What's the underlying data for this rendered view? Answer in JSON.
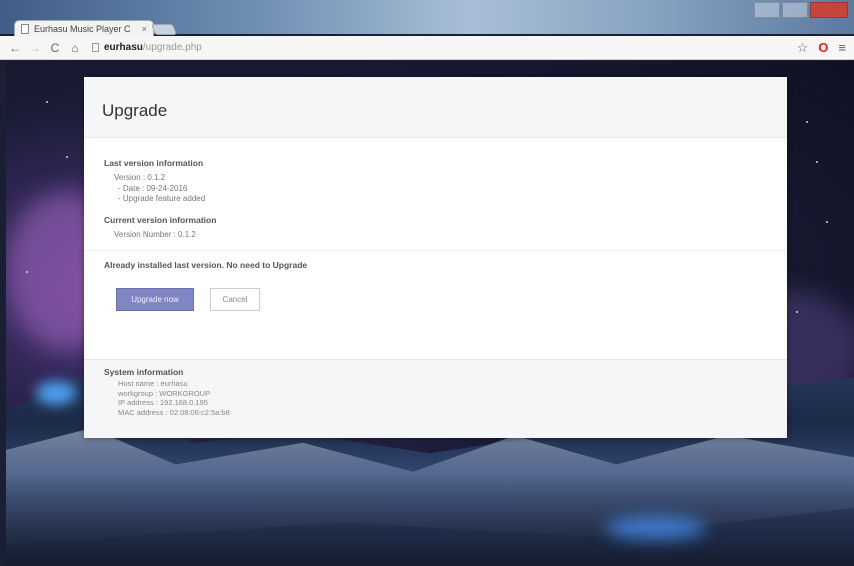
{
  "browser": {
    "tab_title": "Eurhasu Music Player C",
    "tab_close": "×",
    "back": "←",
    "forward": "→",
    "reload": "C",
    "home": "⌂",
    "url_host": "eurhasu",
    "url_path": "/upgrade.php",
    "star": "☆",
    "opera": "O",
    "menu": "≡"
  },
  "page": {
    "title": "Upgrade",
    "last_version": {
      "heading": "Last version information",
      "version": "Version : 0.1.2",
      "date": "- Date : 09-24-2016",
      "features": "- Upgrade feature added"
    },
    "current_version": {
      "heading": "Current version information",
      "number": "Version Number : 0.1.2"
    },
    "status": "Already installed last version. No need to Upgrade",
    "buttons": {
      "upgrade": "Upgrade now",
      "cancel": "Cancel"
    },
    "system": {
      "heading": "System information",
      "host": "Host name : eurhasu",
      "workgroup": "workgroup : WORKGROUP",
      "ip": "IP address : 192.168.0.195",
      "mac": "MAC address : 02:08:06:c2:5a:b8"
    }
  },
  "colors": {
    "primary_button": "#7f86c2",
    "panel_header": "#f4f6f8",
    "close_button": "#c7443b"
  }
}
